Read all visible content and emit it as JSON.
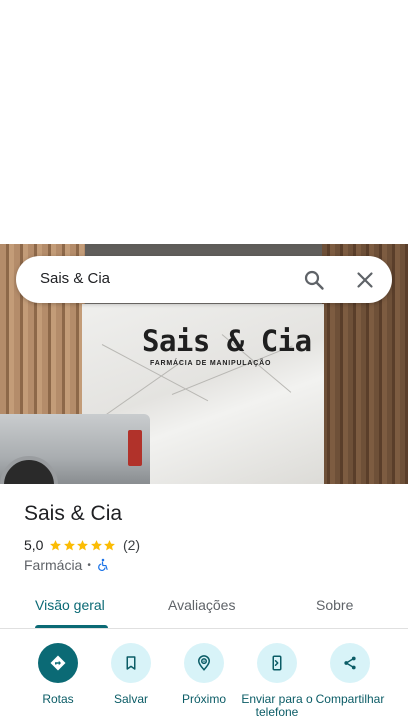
{
  "search": {
    "query": "Sais & Cia"
  },
  "hero": {
    "sign_title": "Sais & Cia",
    "sign_subtitle": "FARMÁCIA DE MANIPULAÇÃO"
  },
  "place": {
    "name": "Sais & Cia",
    "rating": "5,0",
    "stars": 5,
    "reviews": "(2)",
    "category": "Farmácia",
    "separator": "•"
  },
  "tabs": [
    {
      "label": "Visão geral",
      "active": true
    },
    {
      "label": "Avaliações",
      "active": false
    },
    {
      "label": "Sobre",
      "active": false
    }
  ],
  "actions": [
    {
      "label": "Rotas",
      "icon": "directions-icon"
    },
    {
      "label": "Salvar",
      "icon": "bookmark-icon"
    },
    {
      "label": "Próximo",
      "icon": "nearby-icon"
    },
    {
      "label": "Enviar para o telefone",
      "icon": "send-to-phone-icon"
    },
    {
      "label": "Compartilhar",
      "icon": "share-icon"
    }
  ],
  "colors": {
    "accent": "#0b6a75",
    "action_bg": "#d8f3f8",
    "star": "#fbbc04",
    "accessibility": "#1a73e8"
  }
}
